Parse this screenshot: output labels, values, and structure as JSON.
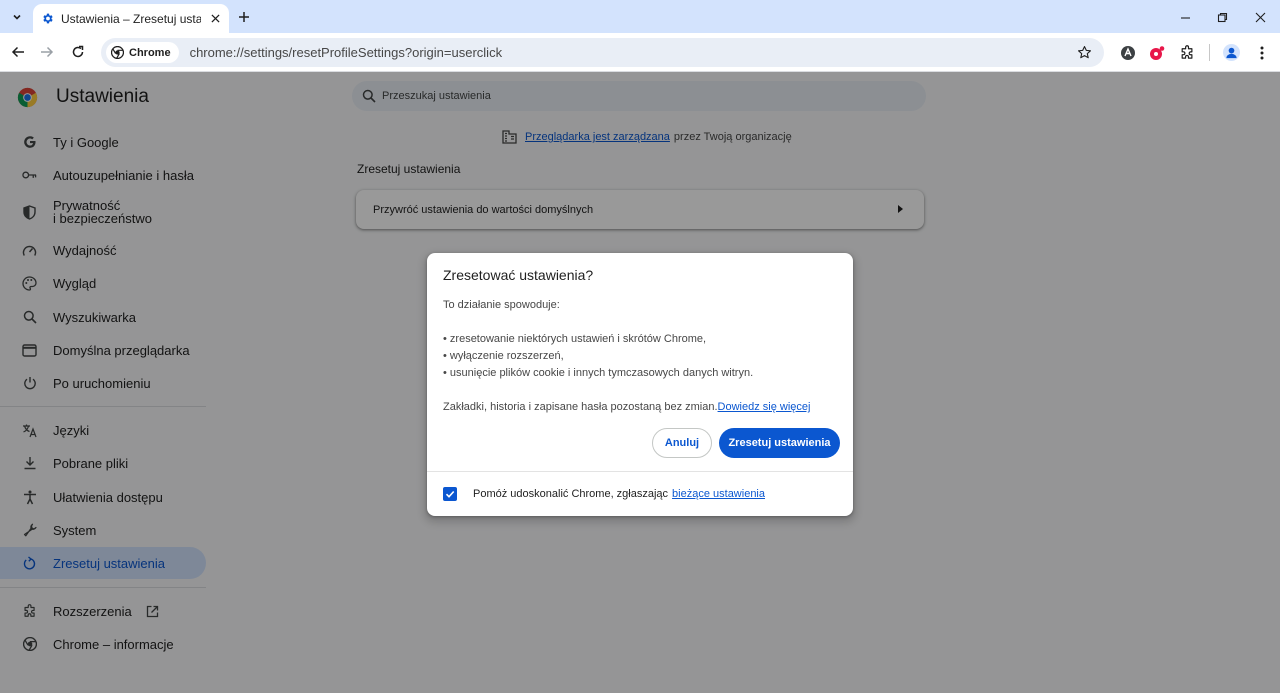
{
  "browser": {
    "tab": {
      "title": "Ustawienia – Zresetuj ustawienia"
    },
    "omnibox": {
      "chip_label": "Chrome",
      "url": "chrome://settings/resetProfileSettings?origin=userclick"
    }
  },
  "settings": {
    "title": "Ustawienia",
    "search_placeholder": "Przeszukaj ustawienia",
    "nav": [
      {
        "label": "Ty i Google",
        "icon": "google-g-icon"
      },
      {
        "label": "Autouzupełnianie i hasła",
        "icon": "key-icon"
      },
      {
        "label": "Prywatność\ni bezpieczeństwo",
        "icon": "shield-icon"
      },
      {
        "label": "Wydajność",
        "icon": "gauge-icon"
      },
      {
        "label": "Wygląd",
        "icon": "palette-icon"
      },
      {
        "label": "Wyszukiwarka",
        "icon": "search-icon"
      },
      {
        "label": "Domyślna przeglądarka",
        "icon": "browser-window-icon"
      },
      {
        "label": "Po uruchomieniu",
        "icon": "power-icon"
      },
      {
        "label": "Języki",
        "icon": "translate-icon"
      },
      {
        "label": "Pobrane pliki",
        "icon": "download-icon"
      },
      {
        "label": "Ułatwienia dostępu",
        "icon": "accessibility-icon"
      },
      {
        "label": "System",
        "icon": "wrench-icon"
      },
      {
        "label": "Zresetuj ustawienia",
        "icon": "reset-icon"
      },
      {
        "label": "Rozszerzenia",
        "icon": "puzzle-icon"
      },
      {
        "label": "Chrome – informacje",
        "icon": "chrome-icon"
      }
    ],
    "managed": {
      "link": "Przeglądarka jest zarządzana",
      "text": "przez Twoją organizację"
    },
    "section_title": "Zresetuj ustawienia",
    "card_label": "Przywróć ustawienia do wartości domyślnych"
  },
  "dialog": {
    "title": "Zresetować ustawienia?",
    "intro": "To działanie spowoduje:",
    "bullets": [
      "• zresetowanie niektórych ustawień i skrótów Chrome,",
      "• wyłączenie rozszerzeń,",
      "• usunięcie plików cookie i innych tymczasowych danych witryn."
    ],
    "note": "Zakładki, historia i zapisane hasła pozostaną bez zmian.",
    "learn_more": "Dowiedz się więcej",
    "cancel_label": "Anuluj",
    "reset_label": "Zresetuj ustawienia",
    "footer_text": "Pomóż udoskonalić Chrome, zgłaszając",
    "footer_link": "bieżące ustawienia",
    "footer_checked": true
  },
  "colors": {
    "accent": "#0b57d0",
    "tabstrip": "#d3e3fd",
    "active_nav": "#d3e3fd"
  }
}
